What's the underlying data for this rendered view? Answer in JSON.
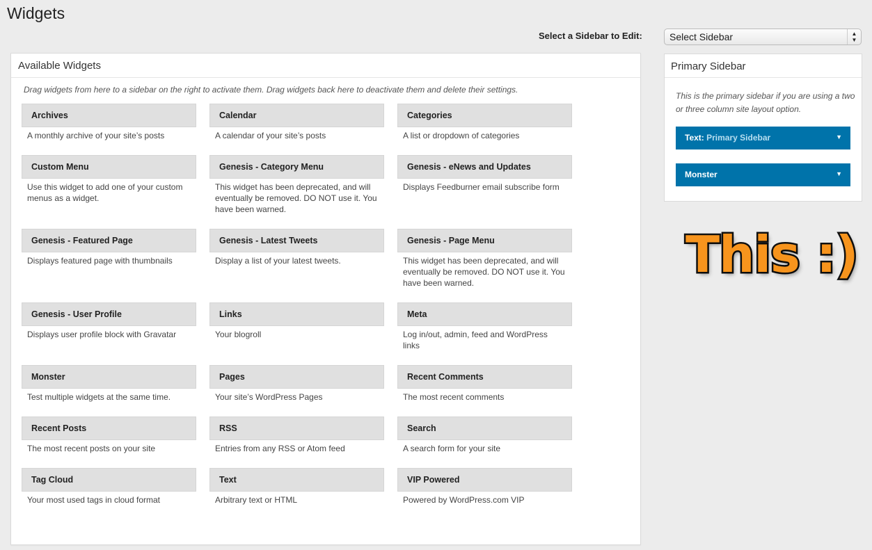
{
  "page": {
    "title": "Widgets"
  },
  "sidebar_select": {
    "label": "Select a Sidebar to Edit:",
    "value": "Select Sidebar"
  },
  "available": {
    "title": "Available Widgets",
    "description": "Drag widgets from here to a sidebar on the right to activate them. Drag widgets back here to deactivate them and delete their settings.",
    "widgets": [
      {
        "title": "Archives",
        "desc": "A monthly archive of your site’s posts"
      },
      {
        "title": "Calendar",
        "desc": "A calendar of your site’s posts"
      },
      {
        "title": "Categories",
        "desc": "A list or dropdown of categories"
      },
      {
        "title": "Custom Menu",
        "desc": "Use this widget to add one of your custom menus as a widget."
      },
      {
        "title": "Genesis - Category Menu",
        "desc": "This widget has been deprecated, and will eventually be removed. DO NOT use it. You have been warned."
      },
      {
        "title": "Genesis - eNews and Updates",
        "desc": "Displays Feedburner email subscribe form"
      },
      {
        "title": "Genesis - Featured Page",
        "desc": "Displays featured page with thumbnails"
      },
      {
        "title": "Genesis - Latest Tweets",
        "desc": "Display a list of your latest tweets."
      },
      {
        "title": "Genesis - Page Menu",
        "desc": "This widget has been deprecated, and will eventually be removed. DO NOT use it. You have been warned."
      },
      {
        "title": "Genesis - User Profile",
        "desc": "Displays user profile block with Gravatar"
      },
      {
        "title": "Links",
        "desc": "Your blogroll"
      },
      {
        "title": "Meta",
        "desc": "Log in/out, admin, feed and WordPress links"
      },
      {
        "title": "Monster",
        "desc": "Test multiple widgets at the same time."
      },
      {
        "title": "Pages",
        "desc": "Your site’s WordPress Pages"
      },
      {
        "title": "Recent Comments",
        "desc": "The most recent comments"
      },
      {
        "title": "Recent Posts",
        "desc": "The most recent posts on your site"
      },
      {
        "title": "RSS",
        "desc": "Entries from any RSS or Atom feed"
      },
      {
        "title": "Search",
        "desc": "A search form for your site"
      },
      {
        "title": "Tag Cloud",
        "desc": "Your most used tags in cloud format"
      },
      {
        "title": "Text",
        "desc": "Arbitrary text or HTML"
      },
      {
        "title": "VIP Powered",
        "desc": "Powered by WordPress.com VIP"
      }
    ]
  },
  "primary_sidebar": {
    "title": "Primary Sidebar",
    "description": "This is the primary sidebar if you are using a two or three column site layout option.",
    "widgets": [
      {
        "type": "Text:",
        "name": "Primary Sidebar"
      },
      {
        "type": "Monster",
        "name": ""
      }
    ]
  },
  "annotation": {
    "text": "This :)"
  },
  "colors": {
    "background": "#ececec",
    "widget_blue": "#0073aa",
    "annotation_orange": "#f7941d"
  }
}
